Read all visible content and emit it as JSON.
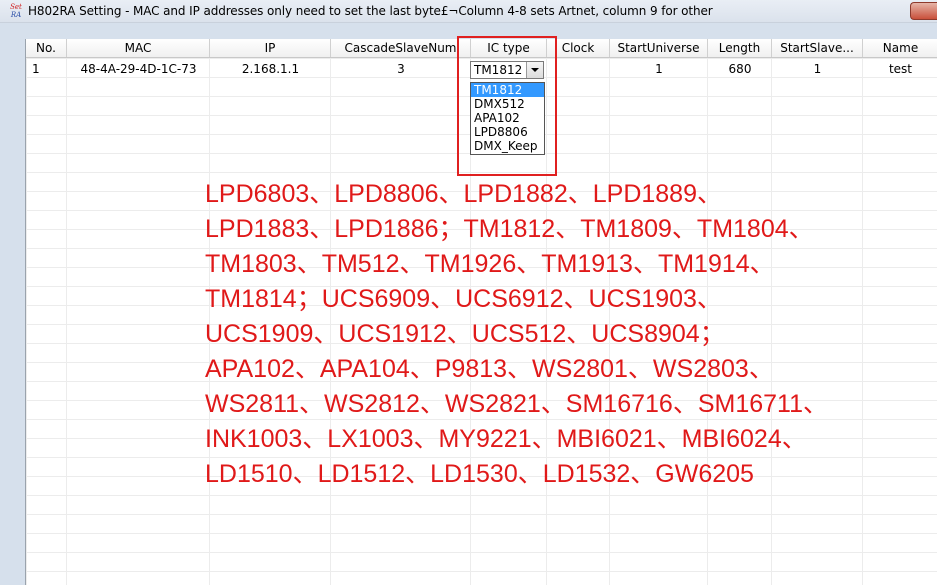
{
  "window": {
    "title": "H802RA Setting - MAC and IP addresses only need to set the last byte£¬Column 4-8 sets Artnet, column 9 for other",
    "icon_text_top": "Set",
    "icon_text_bottom": "RA"
  },
  "icons": {
    "app": "settings-app-icon",
    "close": "close-icon",
    "dropdown": "chevron-down-icon"
  },
  "colors": {
    "annotation": "#e01919",
    "highlight_box": "#e02020",
    "selection": "#3399ff"
  },
  "table": {
    "columns": [
      "No.",
      "MAC",
      "IP",
      "CascadeSlaveNum",
      "IC type",
      "Clock",
      "StartUniverse",
      "Length",
      "StartSlave...",
      "Name"
    ],
    "rows": [
      {
        "no": "1",
        "mac": "48-4A-29-4D-1C-73",
        "ip": "2.168.1.1",
        "cascade_slave_num": "3",
        "ic_type": "TM1812",
        "clock": "",
        "start_universe": "1",
        "length": "680",
        "start_slave": "1",
        "name": "test"
      }
    ]
  },
  "ic_dropdown": {
    "selected": "TM1812",
    "options": [
      "TM1812",
      "DMX512",
      "APA102",
      "LPD8806",
      "DMX_Keep"
    ]
  },
  "annotation_lines": [
    "LPD6803、LPD8806、LPD1882、LPD1889、",
    "LPD1883、LPD1886；TM1812、TM1809、TM1804、",
    "TM1803、TM512、TM1926、TM1913、TM1914、",
    "TM1814；UCS6909、UCS6912、UCS1903、",
    "UCS1909、UCS1912、UCS512、UCS8904；",
    "APA102、APA104、P9813、WS2801、WS2803、",
    "WS2811、WS2812、WS2821、SM16716、SM16711、",
    "INK1003、LX1003、MY9221、MBI6021、MBI6024、",
    "LD1510、LD1512、LD1530、LD1532、GW6205"
  ]
}
